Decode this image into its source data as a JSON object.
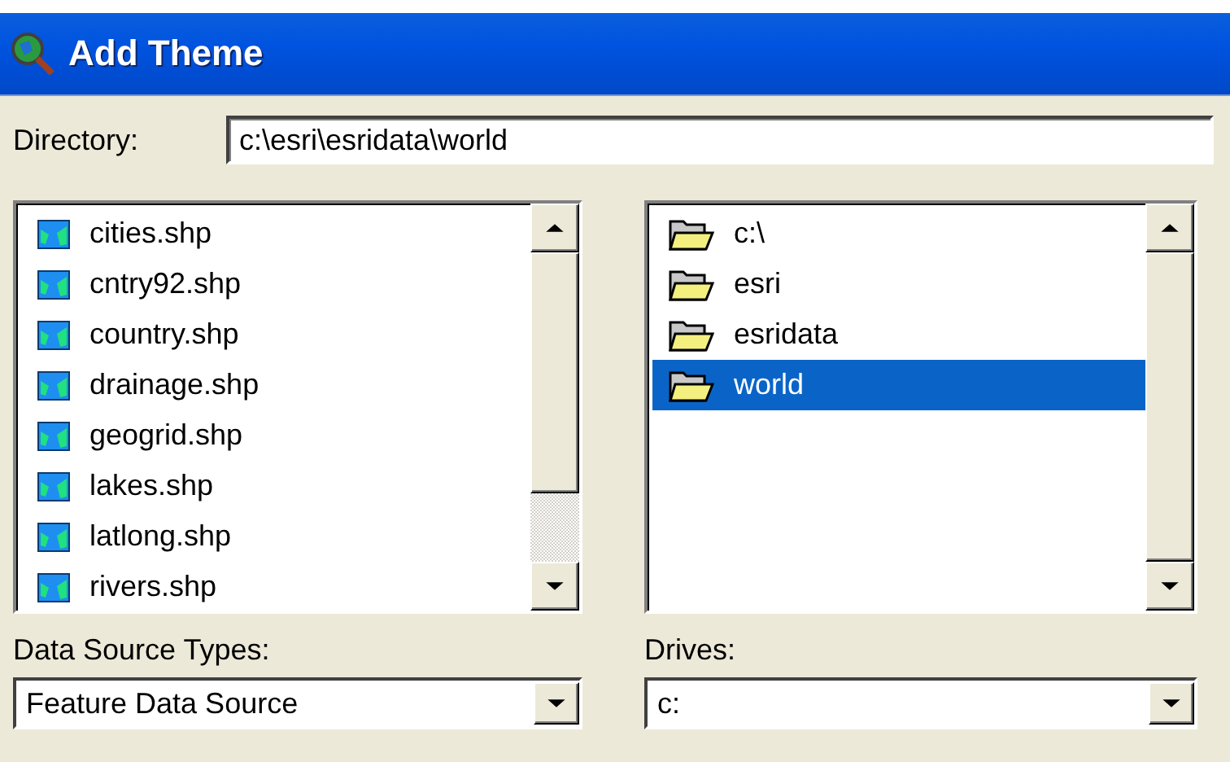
{
  "window": {
    "title": "Add Theme"
  },
  "directory": {
    "label": "Directory:",
    "value": "c:\\esri\\esridata\\world"
  },
  "files": [
    {
      "name": "cities.shp",
      "selected": false
    },
    {
      "name": "cntry92.shp",
      "selected": false
    },
    {
      "name": "country.shp",
      "selected": false
    },
    {
      "name": "drainage.shp",
      "selected": false
    },
    {
      "name": "geogrid.shp",
      "selected": false
    },
    {
      "name": "lakes.shp",
      "selected": false
    },
    {
      "name": "latlong.shp",
      "selected": false
    },
    {
      "name": "rivers.shp",
      "selected": false
    }
  ],
  "folders": [
    {
      "name": "c:\\",
      "selected": false
    },
    {
      "name": "esri",
      "selected": false
    },
    {
      "name": "esridata",
      "selected": false
    },
    {
      "name": "world",
      "selected": true
    }
  ],
  "data_source_types": {
    "label": "Data Source Types:",
    "value": "Feature Data Source"
  },
  "drives": {
    "label": "Drives:",
    "value": "c:"
  }
}
